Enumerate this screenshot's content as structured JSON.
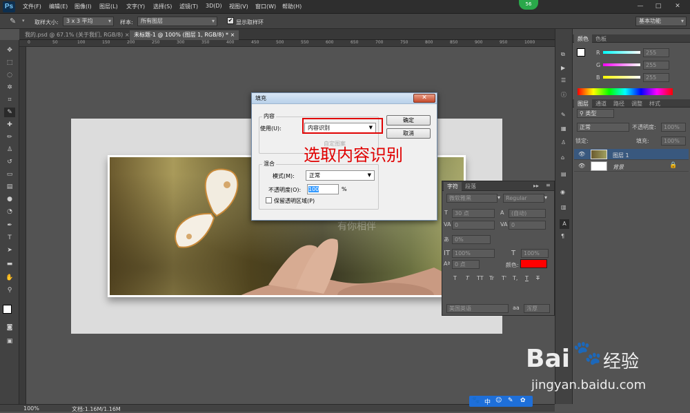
{
  "menubar": {
    "logo": "Ps",
    "items": [
      "文件(F)",
      "编辑(E)",
      "图像(I)",
      "图层(L)",
      "文字(Y)",
      "选择(S)",
      "滤镜(T)",
      "3D(D)",
      "视图(V)",
      "窗口(W)",
      "帮助(H)"
    ],
    "badge": "56",
    "win_min": "—",
    "win_max": "□",
    "win_close": "✕"
  },
  "options": {
    "sample_size_label": "取样大小:",
    "sample_size_value": "3 x 3 平均",
    "sample_label": "样本:",
    "sample_value": "所有图层",
    "show_ring_label": "显示取样环",
    "workspace": "基本功能"
  },
  "tabs": [
    {
      "label": "我的.psd @ 67.1% (关于我们, RGB/8)",
      "close": "×"
    },
    {
      "label": "未标题-1 @ 100% (图层 1, RGB/8) *",
      "close": "×"
    }
  ],
  "ruler": [
    "0",
    "50",
    "100",
    "150",
    "200",
    "250",
    "300",
    "350",
    "400",
    "450",
    "500",
    "550",
    "600",
    "650",
    "700",
    "750",
    "800",
    "850",
    "900",
    "950",
    "1000"
  ],
  "statusbar": {
    "zoom": "100%",
    "doc": "文档:1.16M/1.16M"
  },
  "dialog": {
    "title": "填充",
    "close": "✕",
    "contents_group": "内容",
    "use_label": "使用(U):",
    "use_value": "内容识别",
    "custom_pattern": "自定图案",
    "ok": "确定",
    "cancel": "取消",
    "blend_group": "混合",
    "mode_label": "模式(M):",
    "mode_value": "正常",
    "opacity_label": "不透明度(O):",
    "opacity_value": "100",
    "opacity_unit": "%",
    "preserve_label": "保留透明区域(P)"
  },
  "annotation": "选取内容识别",
  "character_panel": {
    "tab_char": "字符",
    "tab_para": "段落",
    "font": "微软雅黑",
    "style": "Regular",
    "size": "30 点",
    "leading": "(自动)",
    "kerning": "0",
    "tracking": "0",
    "scale_v_pct": "0%",
    "vscale": "100%",
    "hscale": "100%",
    "baseline": "0 点",
    "color_label": "颜色:",
    "text_color": "#ff0000",
    "style_buttons": [
      "T",
      "T",
      "TT",
      "Tr",
      "T'",
      "T,",
      "T",
      "T"
    ],
    "language": "美国英语",
    "aa_icon": "aa",
    "aa_value": "浑厚"
  },
  "color_panel": {
    "tab_color": "颜色",
    "tab_swatches": "色板",
    "r_label": "R",
    "g_label": "G",
    "b_label": "B",
    "r": "255",
    "g": "255",
    "b": "255"
  },
  "layers_panel": {
    "tabs": [
      "图层",
      "通道",
      "路径",
      "调整",
      "样式"
    ],
    "filter": "类型",
    "blend": "正常",
    "opacity_label": "不透明度:",
    "opacity": "100%",
    "lock_label": "锁定:",
    "fill_label": "填充:",
    "fill": "100%",
    "layers": [
      {
        "name": "图层 1"
      },
      {
        "name": "背景"
      }
    ]
  },
  "watermark": {
    "brand": "Bai",
    "brand2": "du",
    "cn": "经验",
    "url": "jingyan.baidu.com",
    "bottom_icons": [
      "中",
      "☺",
      "✎",
      "✿"
    ]
  },
  "photo_text": "有你相伴"
}
